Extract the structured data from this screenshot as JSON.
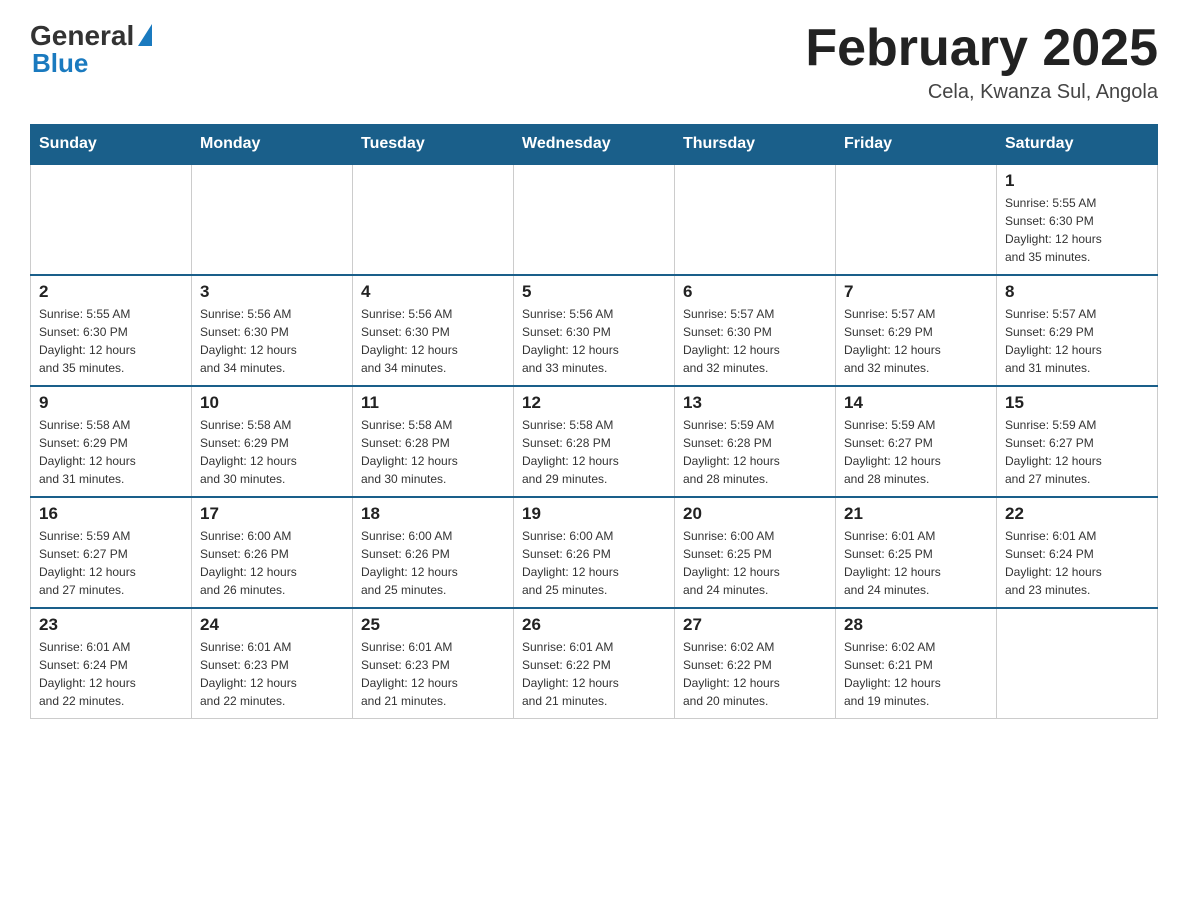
{
  "header": {
    "logo_general": "General",
    "logo_blue": "Blue",
    "title": "February 2025",
    "subtitle": "Cela, Kwanza Sul, Angola"
  },
  "days_of_week": [
    "Sunday",
    "Monday",
    "Tuesday",
    "Wednesday",
    "Thursday",
    "Friday",
    "Saturday"
  ],
  "weeks": [
    {
      "days": [
        {
          "number": "",
          "info": ""
        },
        {
          "number": "",
          "info": ""
        },
        {
          "number": "",
          "info": ""
        },
        {
          "number": "",
          "info": ""
        },
        {
          "number": "",
          "info": ""
        },
        {
          "number": "",
          "info": ""
        },
        {
          "number": "1",
          "info": "Sunrise: 5:55 AM\nSunset: 6:30 PM\nDaylight: 12 hours\nand 35 minutes."
        }
      ]
    },
    {
      "days": [
        {
          "number": "2",
          "info": "Sunrise: 5:55 AM\nSunset: 6:30 PM\nDaylight: 12 hours\nand 35 minutes."
        },
        {
          "number": "3",
          "info": "Sunrise: 5:56 AM\nSunset: 6:30 PM\nDaylight: 12 hours\nand 34 minutes."
        },
        {
          "number": "4",
          "info": "Sunrise: 5:56 AM\nSunset: 6:30 PM\nDaylight: 12 hours\nand 34 minutes."
        },
        {
          "number": "5",
          "info": "Sunrise: 5:56 AM\nSunset: 6:30 PM\nDaylight: 12 hours\nand 33 minutes."
        },
        {
          "number": "6",
          "info": "Sunrise: 5:57 AM\nSunset: 6:30 PM\nDaylight: 12 hours\nand 32 minutes."
        },
        {
          "number": "7",
          "info": "Sunrise: 5:57 AM\nSunset: 6:29 PM\nDaylight: 12 hours\nand 32 minutes."
        },
        {
          "number": "8",
          "info": "Sunrise: 5:57 AM\nSunset: 6:29 PM\nDaylight: 12 hours\nand 31 minutes."
        }
      ]
    },
    {
      "days": [
        {
          "number": "9",
          "info": "Sunrise: 5:58 AM\nSunset: 6:29 PM\nDaylight: 12 hours\nand 31 minutes."
        },
        {
          "number": "10",
          "info": "Sunrise: 5:58 AM\nSunset: 6:29 PM\nDaylight: 12 hours\nand 30 minutes."
        },
        {
          "number": "11",
          "info": "Sunrise: 5:58 AM\nSunset: 6:28 PM\nDaylight: 12 hours\nand 30 minutes."
        },
        {
          "number": "12",
          "info": "Sunrise: 5:58 AM\nSunset: 6:28 PM\nDaylight: 12 hours\nand 29 minutes."
        },
        {
          "number": "13",
          "info": "Sunrise: 5:59 AM\nSunset: 6:28 PM\nDaylight: 12 hours\nand 28 minutes."
        },
        {
          "number": "14",
          "info": "Sunrise: 5:59 AM\nSunset: 6:27 PM\nDaylight: 12 hours\nand 28 minutes."
        },
        {
          "number": "15",
          "info": "Sunrise: 5:59 AM\nSunset: 6:27 PM\nDaylight: 12 hours\nand 27 minutes."
        }
      ]
    },
    {
      "days": [
        {
          "number": "16",
          "info": "Sunrise: 5:59 AM\nSunset: 6:27 PM\nDaylight: 12 hours\nand 27 minutes."
        },
        {
          "number": "17",
          "info": "Sunrise: 6:00 AM\nSunset: 6:26 PM\nDaylight: 12 hours\nand 26 minutes."
        },
        {
          "number": "18",
          "info": "Sunrise: 6:00 AM\nSunset: 6:26 PM\nDaylight: 12 hours\nand 25 minutes."
        },
        {
          "number": "19",
          "info": "Sunrise: 6:00 AM\nSunset: 6:26 PM\nDaylight: 12 hours\nand 25 minutes."
        },
        {
          "number": "20",
          "info": "Sunrise: 6:00 AM\nSunset: 6:25 PM\nDaylight: 12 hours\nand 24 minutes."
        },
        {
          "number": "21",
          "info": "Sunrise: 6:01 AM\nSunset: 6:25 PM\nDaylight: 12 hours\nand 24 minutes."
        },
        {
          "number": "22",
          "info": "Sunrise: 6:01 AM\nSunset: 6:24 PM\nDaylight: 12 hours\nand 23 minutes."
        }
      ]
    },
    {
      "days": [
        {
          "number": "23",
          "info": "Sunrise: 6:01 AM\nSunset: 6:24 PM\nDaylight: 12 hours\nand 22 minutes."
        },
        {
          "number": "24",
          "info": "Sunrise: 6:01 AM\nSunset: 6:23 PM\nDaylight: 12 hours\nand 22 minutes."
        },
        {
          "number": "25",
          "info": "Sunrise: 6:01 AM\nSunset: 6:23 PM\nDaylight: 12 hours\nand 21 minutes."
        },
        {
          "number": "26",
          "info": "Sunrise: 6:01 AM\nSunset: 6:22 PM\nDaylight: 12 hours\nand 21 minutes."
        },
        {
          "number": "27",
          "info": "Sunrise: 6:02 AM\nSunset: 6:22 PM\nDaylight: 12 hours\nand 20 minutes."
        },
        {
          "number": "28",
          "info": "Sunrise: 6:02 AM\nSunset: 6:21 PM\nDaylight: 12 hours\nand 19 minutes."
        },
        {
          "number": "",
          "info": ""
        }
      ]
    }
  ]
}
